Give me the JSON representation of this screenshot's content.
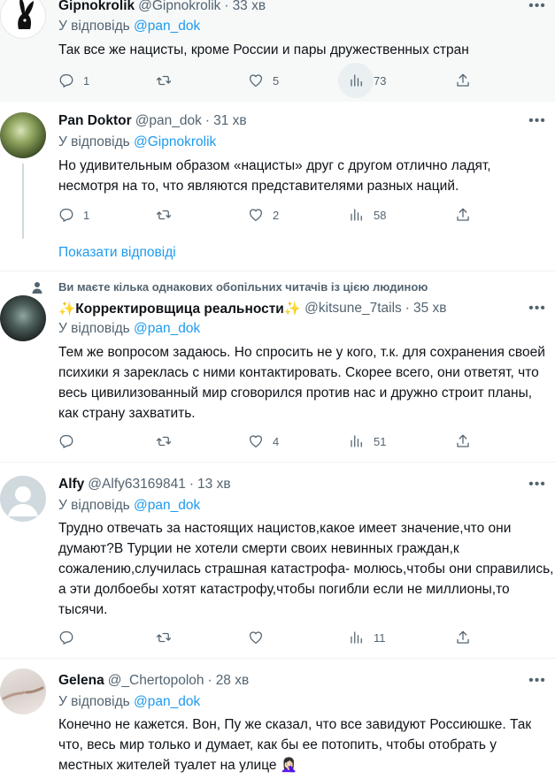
{
  "reply_prefix": "У відповідь",
  "tweets": [
    {
      "name": "Gipnokrolik",
      "handle": "@Gipnokrolik",
      "time": "33 хв",
      "reply_to": "@pan_dok",
      "text": "Так все же нацисты, кроме России и пары дружественных стран",
      "replies": "1",
      "retweets": "",
      "likes": "5",
      "views": "73"
    },
    {
      "name": "Pan Doktor",
      "handle": "@pan_dok",
      "time": "31 хв",
      "reply_to": "@Gipnokrolik",
      "text": "Но удивительным образом «нацисты» друг с другом отлично ладят, несмотря на то, что являются представителями разных наций.",
      "replies": "1",
      "retweets": "",
      "likes": "2",
      "views": "58",
      "show_replies": "Показати відповіді"
    },
    {
      "social_context": "Ви маєте кілька однакових обопільних читачів із цією людиною",
      "name": "✨Корректировщица реальности✨",
      "handle": "@kitsune_7tails",
      "time": "35 хв",
      "reply_to": "@pan_dok",
      "text": "Тем же вопросом задаюсь. Но спросить не у кого, т.к. для сохранения своей психики я зареклась с ними контактировать. Скорее всего, они ответят, что весь цивилизованный мир сговорился против нас и дружно строит планы, как страну захватить.",
      "replies": "",
      "retweets": "",
      "likes": "4",
      "views": "51"
    },
    {
      "name": "Alfy",
      "handle": "@Alfy63169841",
      "time": "13 хв",
      "reply_to": "@pan_dok",
      "text": "Трудно отвечать за настоящих нацистов,какое имеет значение,что они думают?В Турции не хотели смерти своих невинных граждан,к сожалению,случилась страшная катастрофа- молюсь,чтобы они справились, а эти долбоебы хотят катастрофу,чтобы погибли если не миллионы,то тысячи.",
      "replies": "",
      "retweets": "",
      "likes": "",
      "views": "11"
    },
    {
      "name": "Gelena",
      "handle": "@_Chertopoloh",
      "time": "28 хв",
      "reply_to": "@pan_dok",
      "text": "Конечно не кажется. Вон, Пу же сказал, что все завидуют Россиюшке. Так что, весь мир только и думает, как бы ее потопить, чтобы отобрать у местных жителей туалет на улице 🤦🏻‍♀️"
    }
  ],
  "colors": {
    "accent": "#1d9bf0",
    "secondary_text": "#536471",
    "highlight_bg": "#f7f9f9"
  }
}
